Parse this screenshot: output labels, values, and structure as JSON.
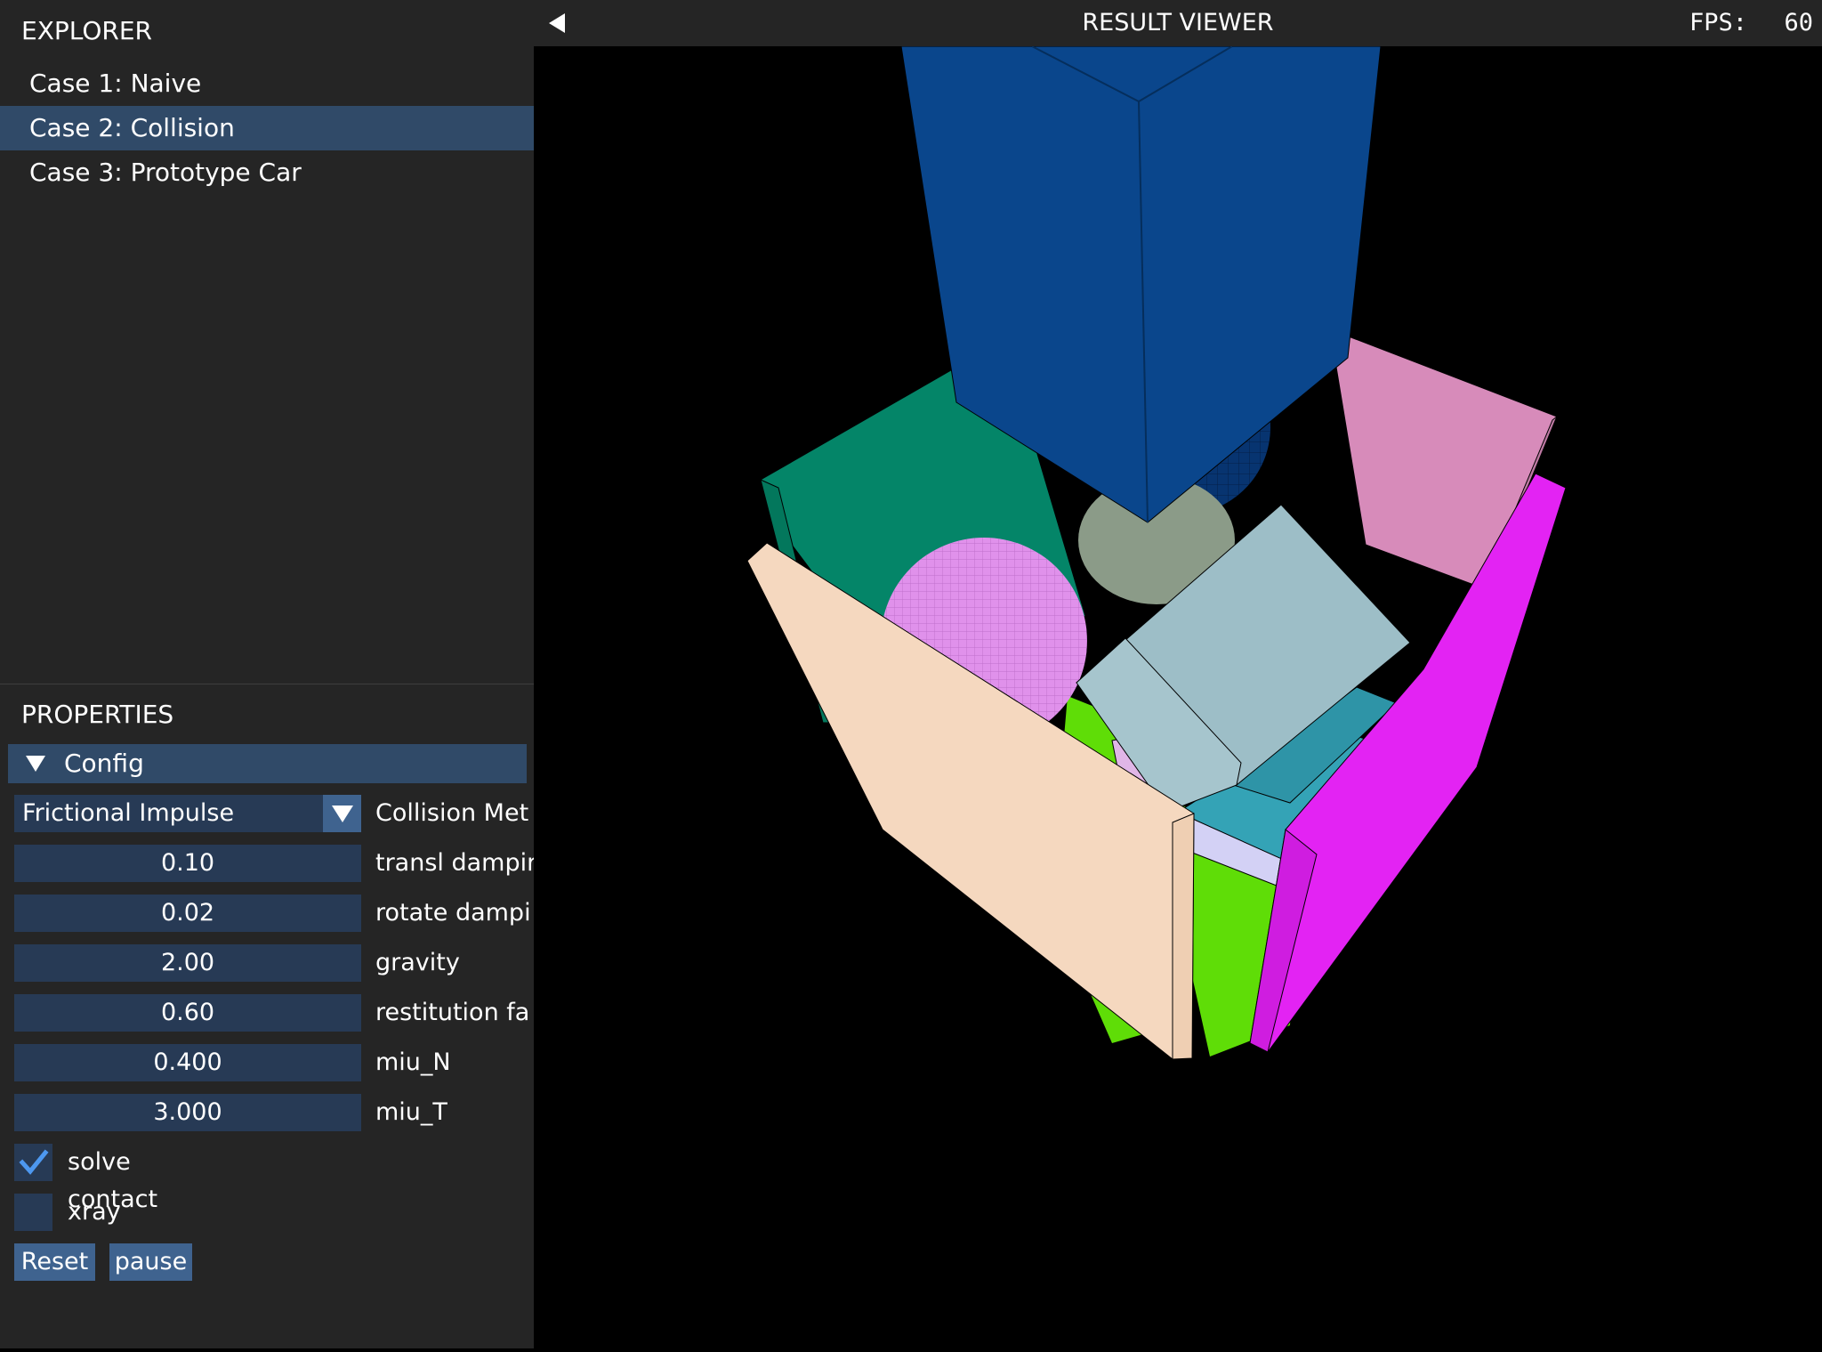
{
  "explorer": {
    "title": "EXPLORER",
    "items": [
      {
        "label": "Case 1: Naive",
        "selected": false
      },
      {
        "label": "Case 2: Collision",
        "selected": true
      },
      {
        "label": "Case 3: Prototype Car",
        "selected": false
      }
    ]
  },
  "properties": {
    "title": "PROPERTIES",
    "section": "Config",
    "collision_method": {
      "value": "Frictional Impulse",
      "label": "Collision Met"
    },
    "fields": [
      {
        "value": "0.10",
        "label": "transl dampir"
      },
      {
        "value": "0.02",
        "label": "rotate dampi"
      },
      {
        "value": "2.00",
        "label": "gravity"
      },
      {
        "value": "0.60",
        "label": "restitution fa"
      },
      {
        "value": "0.400",
        "label": "miu_N"
      },
      {
        "value": "3.000",
        "label": "miu_T"
      }
    ],
    "checkboxes": [
      {
        "label": "solve contact",
        "checked": true
      },
      {
        "label": "xray",
        "checked": false
      }
    ],
    "buttons": {
      "reset": "Reset",
      "pause": "pause"
    }
  },
  "viewer": {
    "title": "RESULT VIEWER",
    "fps_label": "FPS:",
    "fps_value": "60"
  },
  "colors": {
    "panel_bg": "#252525",
    "selection": "#304a68",
    "field_bg": "#273a55",
    "button_bg": "#3f638f",
    "check_accent": "#4d98f0"
  },
  "scene_objects": [
    {
      "name": "dark-blue-box",
      "color": "#0a468c"
    },
    {
      "name": "teal-wall",
      "color": "#048568"
    },
    {
      "name": "pink-wall",
      "color": "#d78bba"
    },
    {
      "name": "magenta-wall",
      "color": "#e323f3"
    },
    {
      "name": "peach-wall",
      "color": "#f5d8bf"
    },
    {
      "name": "green-floor",
      "color": "#5fdd07"
    },
    {
      "name": "violet-sphere",
      "color": "#e091eb"
    },
    {
      "name": "navy-sphere",
      "color": "#073470"
    },
    {
      "name": "light-blue-box",
      "color": "#9dbec7"
    },
    {
      "name": "cyan-box",
      "color": "#34a3b6"
    },
    {
      "name": "lavender-box",
      "color": "#d3d1f5"
    }
  ]
}
